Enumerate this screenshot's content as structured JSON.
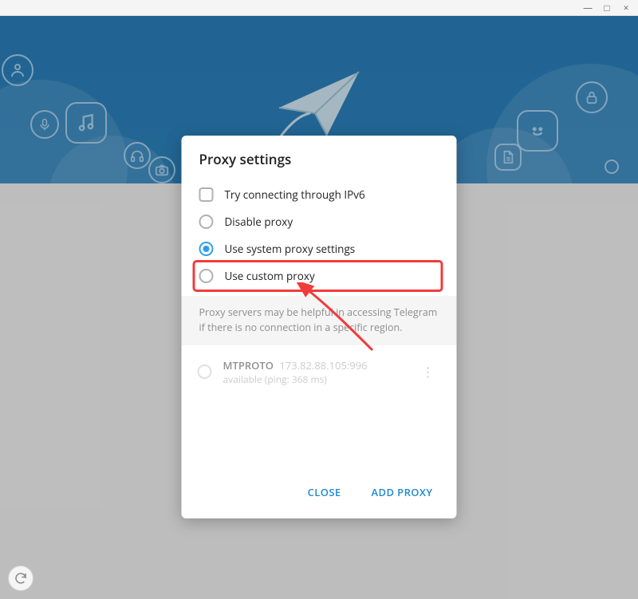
{
  "titlebar": {
    "minimize": "—",
    "maximize": "□",
    "close": "×"
  },
  "dialog": {
    "title": "Proxy settings",
    "options": {
      "ipv6": "Try connecting through IPv6",
      "disable": "Disable proxy",
      "system": "Use system proxy settings",
      "custom": "Use custom proxy"
    },
    "hint": "Proxy servers may be helpful in accessing Telegram if there is no connection in a specific region.",
    "proxies": [
      {
        "protocol": "MTPROTO",
        "address": "173.82.88.105:996",
        "status": "available (ping: 368 ms)"
      }
    ],
    "buttons": {
      "close": "CLOSE",
      "add": "ADD PROXY"
    }
  },
  "colors": {
    "accent": "#2e9fe6",
    "hero": "#2b80ba",
    "highlight": "#f23b3b"
  }
}
